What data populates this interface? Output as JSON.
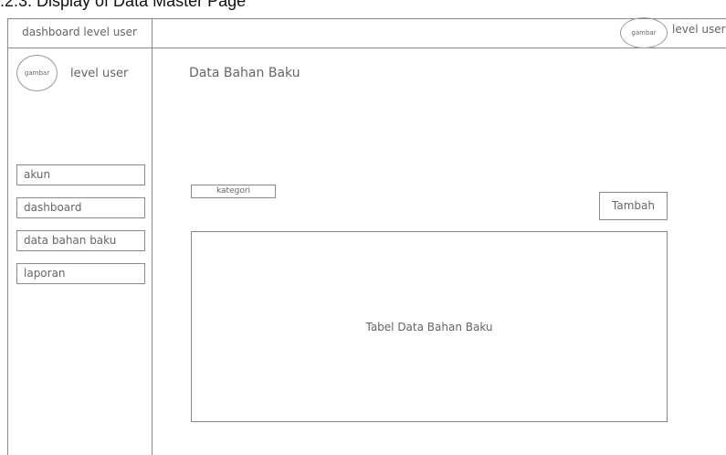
{
  "caption": ".2.3. Display of Data Master Page",
  "sidebar": {
    "title": "dashboard level user",
    "avatar_text": "gambar",
    "user_label": "level user",
    "items": [
      {
        "label": "akun"
      },
      {
        "label": "dashboard"
      },
      {
        "label": "data bahan baku"
      },
      {
        "label": "laporan"
      }
    ]
  },
  "header": {
    "avatar_text": "gambar",
    "user_label": "level user"
  },
  "main": {
    "title": "Data Bahan Baku",
    "category_select": "kategori",
    "add_button": "Tambah",
    "table_placeholder": "Tabel Data Bahan Baku"
  },
  "colors": {
    "line": "#8a8a8a",
    "text": "#666666",
    "background": "#ffffff"
  }
}
